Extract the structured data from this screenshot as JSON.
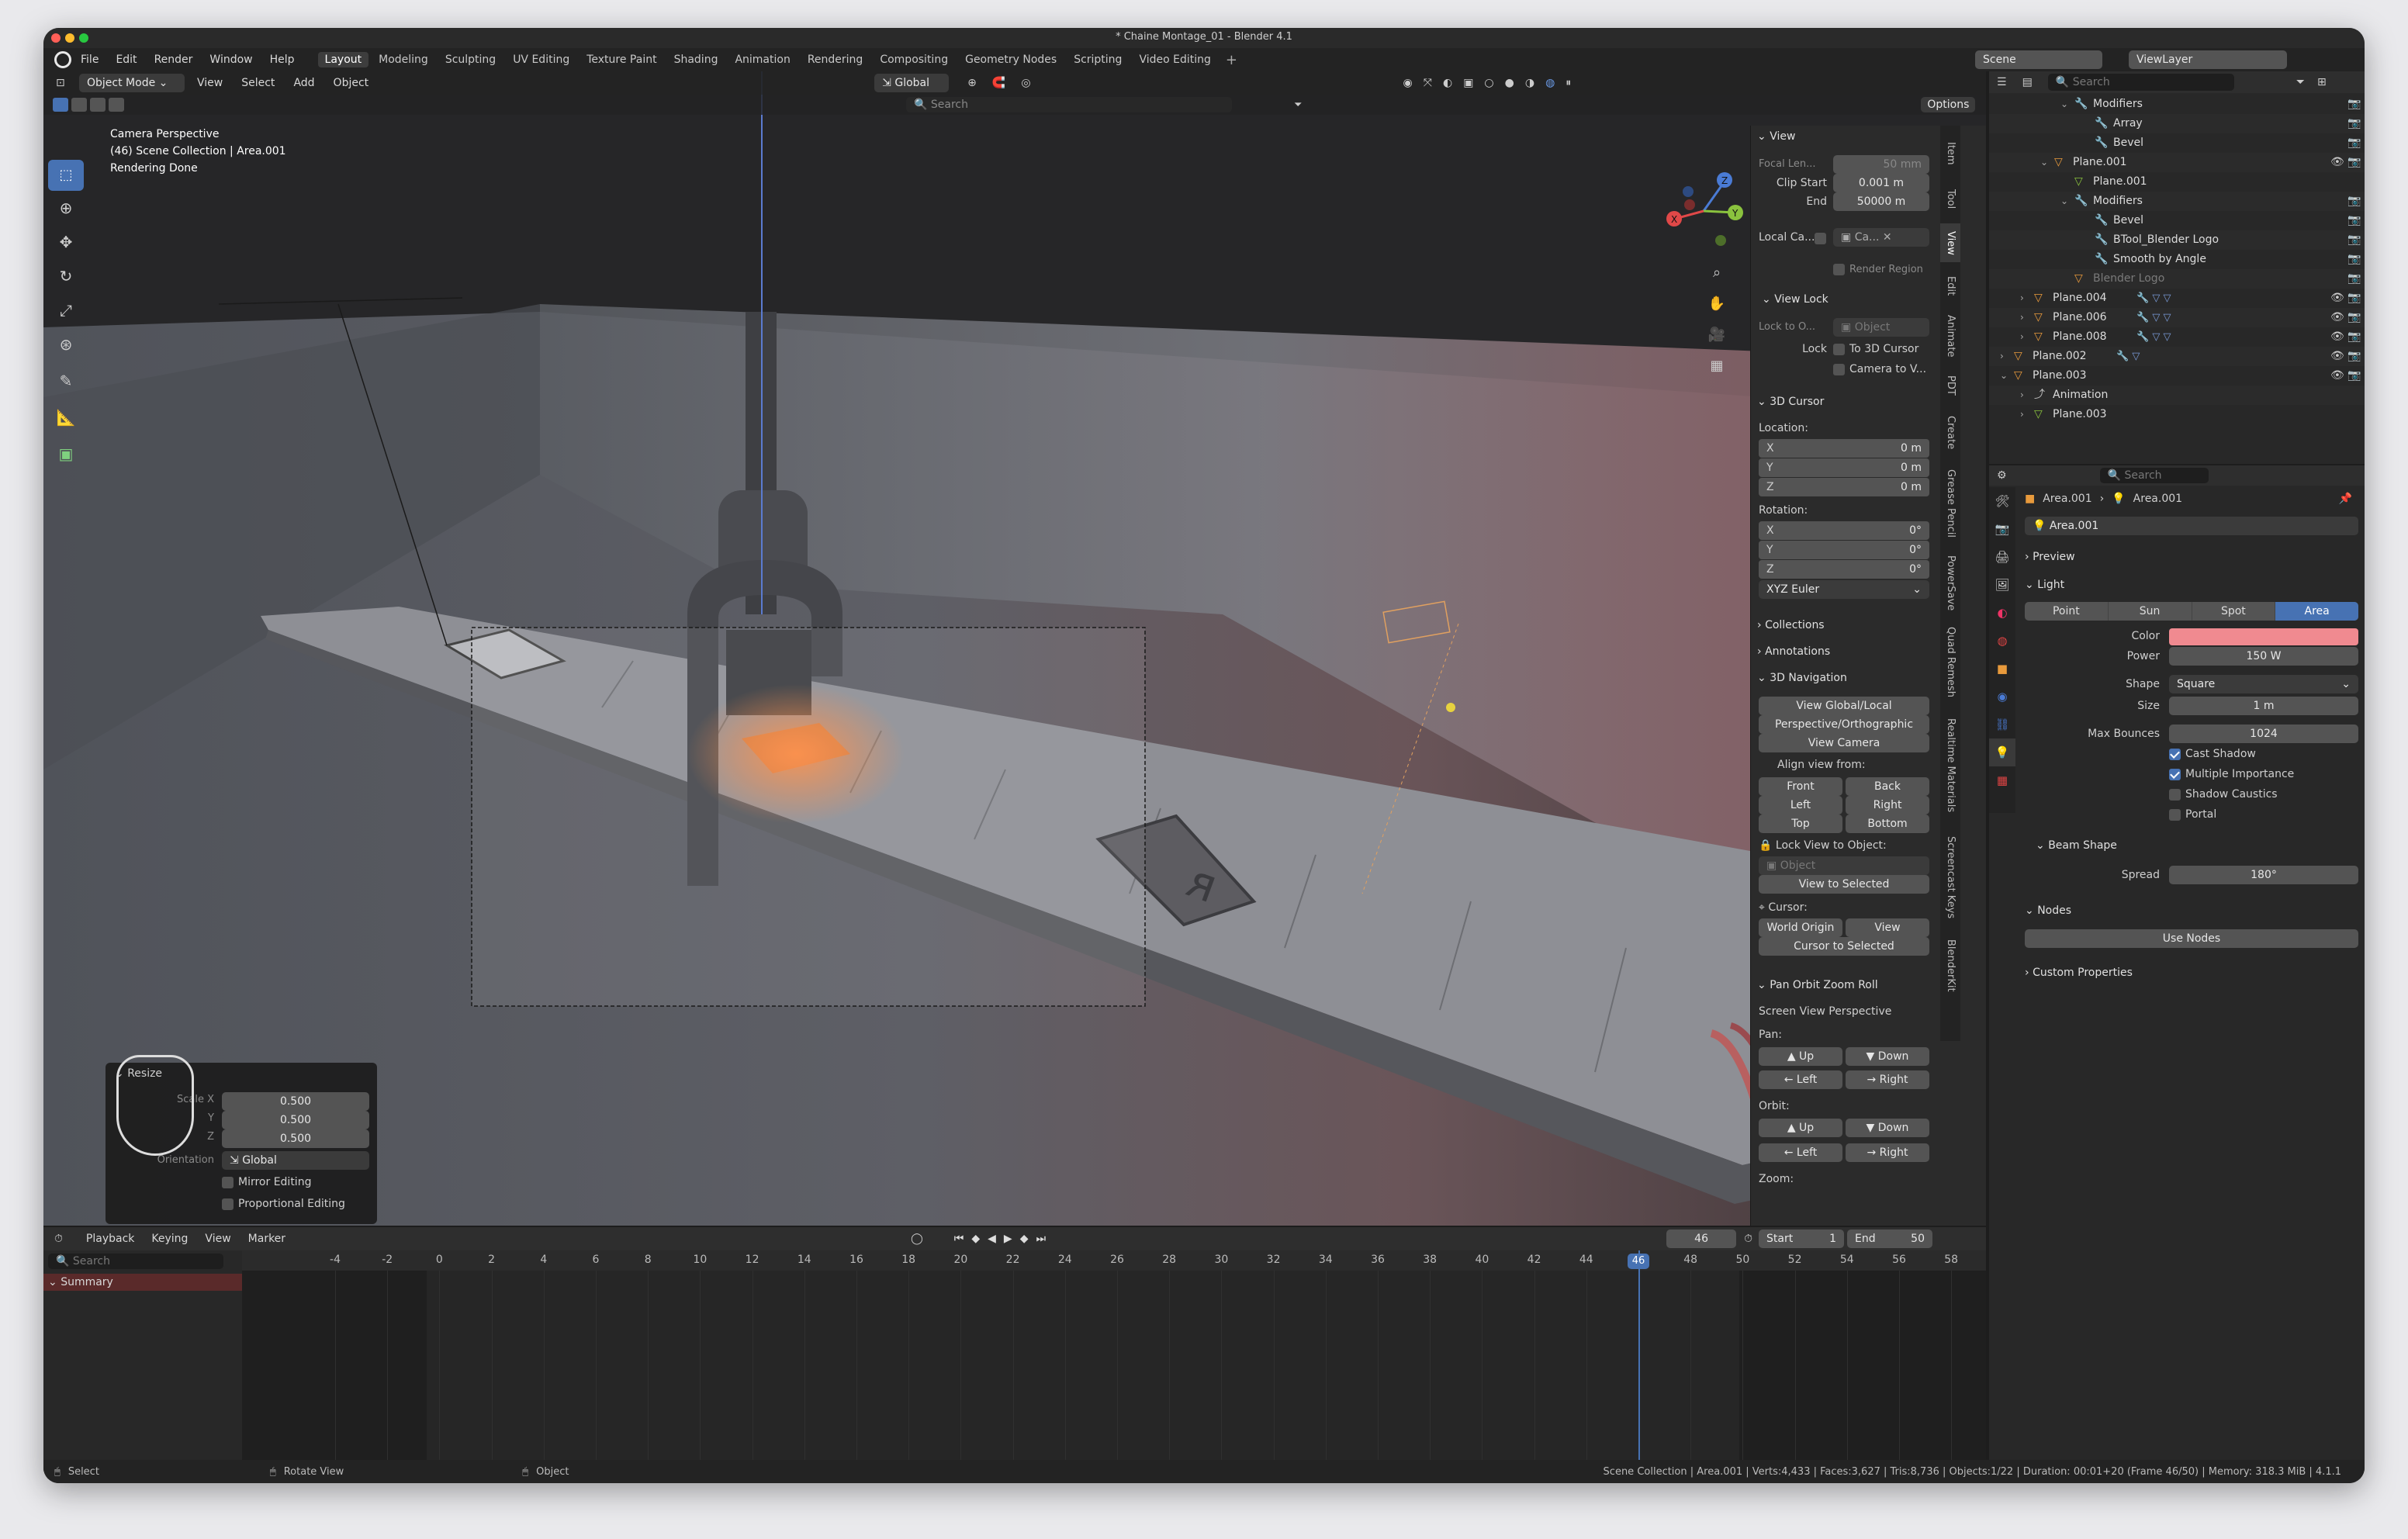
{
  "title": "* Chaine Montage_01 - Blender 4.1",
  "menu": [
    "File",
    "Edit",
    "Render",
    "Window",
    "Help"
  ],
  "workspaces": [
    "Layout",
    "Modeling",
    "Sculpting",
    "UV Editing",
    "Texture Paint",
    "Shading",
    "Animation",
    "Rendering",
    "Compositing",
    "Geometry Nodes",
    "Scripting",
    "Video Editing"
  ],
  "active_workspace": "Layout",
  "scene": "Scene",
  "view_layer": "ViewLayer",
  "viewport": {
    "mode": "Object Mode",
    "menus": [
      "View",
      "Select",
      "Add",
      "Object"
    ],
    "orientation": "Global",
    "search_placeholder": "Search",
    "options": "Options",
    "overlay_lines": [
      "Camera Perspective",
      "(46) Scene Collection | Area.001",
      "Rendering Done"
    ]
  },
  "npanel": {
    "tabs": [
      "Item",
      "Tool",
      "View",
      "Edit",
      "Animate",
      "PDT",
      "Create",
      "Grease Pencil",
      "PowerSave",
      "Quad Remesh",
      "Realtime Materials",
      "Screencast Keys",
      "BlenderKit"
    ],
    "view_header": "View",
    "focal_label": "Focal Len...",
    "focal_value": "50 mm",
    "clip_start_label": "Clip Start",
    "clip_start_value": "0.001 m",
    "end_label": "End",
    "end_value": "50000 m",
    "local_camera_label": "Local Ca...",
    "local_camera_value": "Ca...",
    "render_region": "Render Region",
    "view_lock_header": "View Lock",
    "lock_to_label": "Lock to O...",
    "lock_to_value": "Object",
    "lock_label": "Lock",
    "to_3d_cursor": "To 3D Cursor",
    "camera_to_view": "Camera to V...",
    "cursor_header": "3D Cursor",
    "location_label": "Location:",
    "loc": [
      {
        "axis": "X",
        "value": "0 m"
      },
      {
        "axis": "Y",
        "value": "0 m"
      },
      {
        "axis": "Z",
        "value": "0 m"
      }
    ],
    "rotation_label": "Rotation:",
    "rot": [
      {
        "axis": "X",
        "value": "0°"
      },
      {
        "axis": "Y",
        "value": "0°"
      },
      {
        "axis": "Z",
        "value": "0°"
      }
    ],
    "rotation_mode": "XYZ Euler",
    "collections": "Collections",
    "annotations": "Annotations",
    "nav_header": "3D Navigation",
    "view_global_local": "View Global/Local",
    "persp_ortho": "Perspective/Orthographic",
    "view_camera": "View Camera",
    "align_view_from": "Align view from:",
    "front": "Front",
    "back": "Back",
    "left": "Left",
    "right": "Right",
    "top": "Top",
    "bottom": "Bottom",
    "lock_view_to_object": "Lock View to Object:",
    "object_placeholder": "Object",
    "view_to_selected": "View to Selected",
    "cursor_label": "Cursor:",
    "world_origin": "World Origin",
    "view": "View",
    "cursor_to_selected": "Cursor to Selected",
    "pan_orbit_header": "Pan Orbit Zoom Roll",
    "screen_view_perspective": "Screen View Perspective",
    "pan_label": "Pan:",
    "orbit_label": "Orbit:",
    "zoom_label": "Zoom:",
    "up": "Up",
    "down": "Down"
  },
  "operator_panel": {
    "title": "Resize",
    "scale_label": "Scale X",
    "y_label": "Y",
    "z_label": "Z",
    "scale": [
      "0.500",
      "0.500",
      "0.500"
    ],
    "orientation_label": "Orientation",
    "orientation_value": "Global",
    "mirror_editing": "Mirror Editing",
    "proportional_editing": "Proportional Editing"
  },
  "outliner": {
    "search_placeholder": "Search",
    "rows": [
      {
        "name": "Modifiers",
        "indent": 3,
        "kind": "modifier",
        "exp": "v"
      },
      {
        "name": "Array",
        "indent": 4,
        "kind": "wrench"
      },
      {
        "name": "Bevel",
        "indent": 4,
        "kind": "wrench"
      },
      {
        "name": "Plane.001",
        "indent": 2,
        "kind": "mesh",
        "exp": "v",
        "vis": true
      },
      {
        "name": "Plane.001",
        "indent": 3,
        "kind": "data"
      },
      {
        "name": "Modifiers",
        "indent": 3,
        "kind": "modifier",
        "exp": "v"
      },
      {
        "name": "Bevel",
        "indent": 4,
        "kind": "wrench"
      },
      {
        "name": "BTool_Blender Logo",
        "indent": 4,
        "kind": "wrench"
      },
      {
        "name": "Smooth by Angle",
        "indent": 4,
        "kind": "wrench"
      },
      {
        "name": "Blender Logo",
        "indent": 3,
        "kind": "mesh",
        "dim": true
      },
      {
        "name": "Plane.004",
        "indent": 1,
        "kind": "mesh",
        "exp": ">",
        "vis": true,
        "extra": "modifiers-2"
      },
      {
        "name": "Plane.006",
        "indent": 1,
        "kind": "mesh",
        "exp": ">",
        "vis": true,
        "extra": "modifiers-2"
      },
      {
        "name": "Plane.008",
        "indent": 1,
        "kind": "mesh",
        "exp": ">",
        "vis": true,
        "extra": "modifiers-2"
      },
      {
        "name": "Plane.002",
        "indent": 0,
        "kind": "mesh",
        "exp": ">",
        "vis": true,
        "extra": "modifiers"
      },
      {
        "name": "Plane.003",
        "indent": 0,
        "kind": "mesh",
        "exp": "v",
        "vis": true
      },
      {
        "name": "Animation",
        "indent": 1,
        "kind": "anim",
        "exp": ">"
      },
      {
        "name": "Plane.003",
        "indent": 1,
        "kind": "data",
        "exp": ">"
      }
    ]
  },
  "properties": {
    "search_placeholder": "Search",
    "breadcrumb_object": "Area.001",
    "breadcrumb_data": "Area.001",
    "datablock": "Area.001",
    "preview": "Preview",
    "light_header": "Light",
    "light_types": [
      "Point",
      "Sun",
      "Spot",
      "Area"
    ],
    "active_light_type": "Area",
    "color_label": "Color",
    "color_value": "#f08a90",
    "power_label": "Power",
    "power_value": "150 W",
    "shape_label": "Shape",
    "shape_value": "Square",
    "size_label": "Size",
    "size_value": "1 m",
    "max_bounces_label": "Max Bounces",
    "max_bounces_value": "1024",
    "cast_shadow": "Cast Shadow",
    "multiple_importance": "Multiple Importance",
    "shadow_caustics": "Shadow Caustics",
    "portal": "Portal",
    "beam_shape": "Beam Shape",
    "spread_label": "Spread",
    "spread_value": "180°",
    "nodes_header": "Nodes",
    "use_nodes": "Use Nodes",
    "custom_properties": "Custom Properties"
  },
  "timeline": {
    "menus": [
      "Playback",
      "Keying",
      "View",
      "Marker"
    ],
    "current_frame": "46",
    "start_label": "Start",
    "start_value": "1",
    "end_label": "End",
    "end_value": "50",
    "search_placeholder": "Search",
    "summary": "Summary",
    "ticks": [
      "-4",
      "-2",
      "0",
      "2",
      "4",
      "6",
      "8",
      "10",
      "12",
      "14",
      "16",
      "18",
      "20",
      "22",
      "24",
      "26",
      "28",
      "30",
      "32",
      "34",
      "36",
      "38",
      "40",
      "42",
      "44",
      "46",
      "48",
      "50",
      "52",
      "54",
      "56",
      "58"
    ],
    "playhead": "46"
  },
  "status": {
    "left": [
      "Select",
      "Rotate View",
      "Object"
    ],
    "right": "Scene Collection | Area.001 | Verts:4,433 | Faces:3,627 | Tris:8,736 | Objects:1/22 | Duration: 00:01+20 (Frame 46/50) | Memory: 318.3 MiB | 4.1.1"
  },
  "colors": {
    "accent": "#4772b3",
    "playhead": "#4772b3",
    "object_orange": "#e89a3c"
  }
}
